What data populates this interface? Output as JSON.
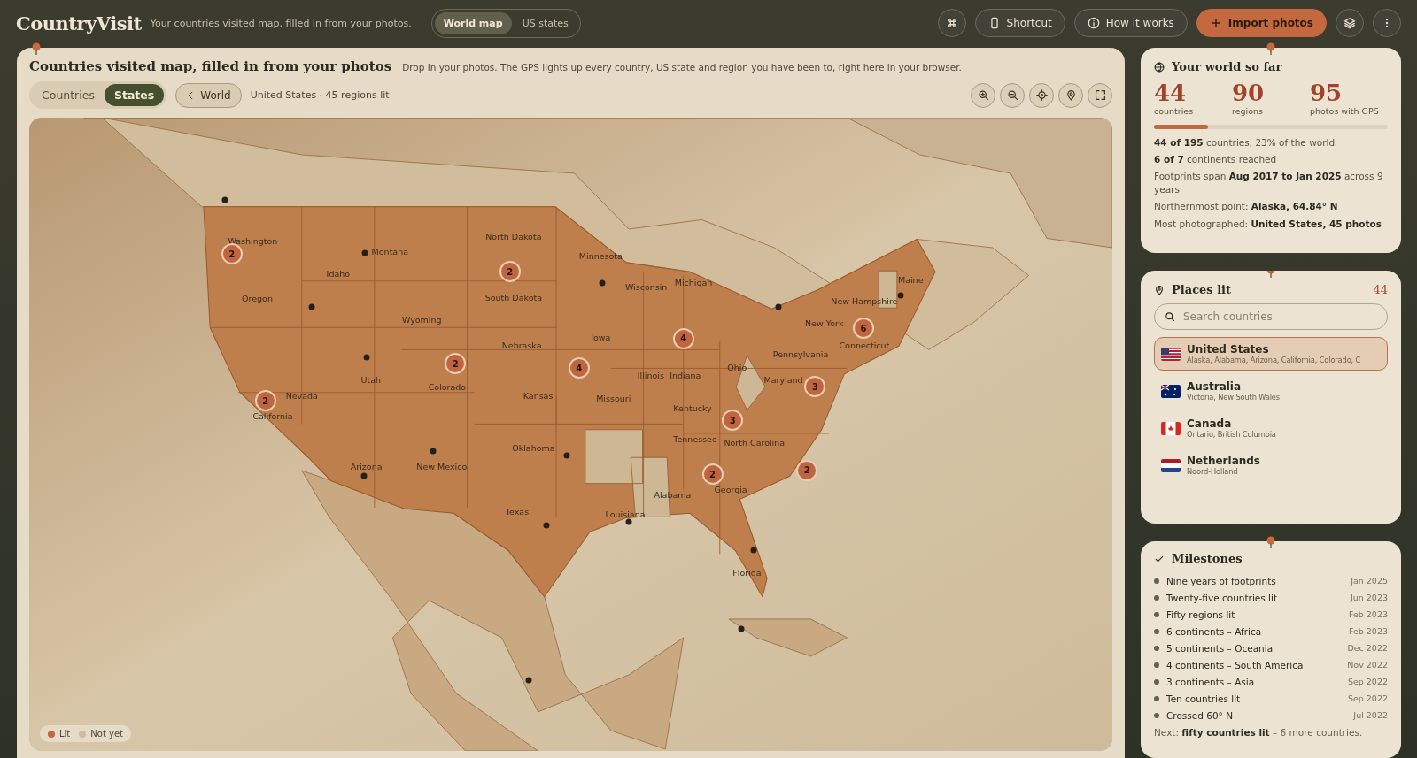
{
  "header": {
    "logo": "CountryVisit",
    "tagline": "Your countries visited map, filled in from your photos.",
    "views": [
      {
        "label": "World map",
        "selected": true
      },
      {
        "label": "US states",
        "selected": false
      }
    ],
    "shortcut": "Shortcut",
    "how": "How it works",
    "import": "Import photos"
  },
  "map_card": {
    "title": "Countries visited map, filled in from your photos",
    "subtitle": "Drop in your photos. The GPS lights up every country, US state and region you have been to, right here in your browser.",
    "levels": [
      {
        "label": "Countries",
        "selected": false
      },
      {
        "label": "States",
        "selected": true
      }
    ],
    "back": "World",
    "status": "United States · 45 regions lit",
    "labels": [
      "Washington",
      "Montana",
      "Idaho",
      "Oregon",
      "North Dakota",
      "Minnesota",
      "South Dakota",
      "Wisconsin",
      "Michigan",
      "Wyoming",
      "Nebraska",
      "Iowa",
      "Maine",
      "New Hampshire",
      "New York",
      "Connecticut",
      "Pennsylvania",
      "Ohio",
      "Illinois",
      "Indiana",
      "Nevada",
      "Utah",
      "Colorado",
      "Kansas",
      "Missouri",
      "Kentucky",
      "Maryland",
      "California",
      "Tennessee",
      "North Carolina",
      "Oklahoma",
      "Arizona",
      "New Mexico",
      "Alabama",
      "Georgia",
      "Texas",
      "Louisiana",
      "Florida"
    ],
    "clusters": [
      {
        "count": "2"
      },
      {
        "count": "2"
      },
      {
        "count": "2"
      },
      {
        "count": "2"
      },
      {
        "count": "4"
      },
      {
        "count": "4"
      },
      {
        "count": "3"
      },
      {
        "count": "6"
      },
      {
        "count": "3"
      },
      {
        "count": "2"
      },
      {
        "count": "2"
      }
    ],
    "legend": [
      {
        "label": "Lit",
        "color": "#c0683f"
      },
      {
        "label": "Not yet",
        "color": "#cdbb9e"
      }
    ]
  },
  "summary": {
    "title": "Your world so far",
    "stats": [
      {
        "value": "44",
        "label": "countries"
      },
      {
        "value": "90",
        "label": "regions"
      },
      {
        "value": "95",
        "label": "photos with GPS"
      }
    ],
    "progress": {
      "level": 0.23
    },
    "facts": [
      "**44 of 195** countries, 23% of the world",
      "**6 of 7** continents reached",
      "Footprints span **Aug 2017 to Jan 2025** across 9 years",
      "Northernmost point: **Alaska, 64.84° N**",
      "Most photographed: **United States, 45 photos**"
    ]
  },
  "places": {
    "title": "Places lit",
    "count": "44",
    "placeholder": "Search countries",
    "items": [
      {
        "name": "United States",
        "regions": "Alaska, Alabama, Arizona, California, Colorado, C",
        "selected": true
      },
      {
        "name": "Australia",
        "regions": "Victoria, New South Wales",
        "selected": false
      },
      {
        "name": "Canada",
        "regions": "Ontario, British Columbia",
        "selected": false
      },
      {
        "name": "Netherlands",
        "regions": "Noord-Holland",
        "selected": false
      }
    ]
  },
  "milestones": {
    "title": "Milestones",
    "items": [
      {
        "label": "Nine years of footprints",
        "date": "Jan 2025"
      },
      {
        "label": "Twenty-five countries lit",
        "date": "Jun 2023"
      },
      {
        "label": "Fifty regions lit",
        "date": "Feb 2023"
      },
      {
        "label": "6 continents – Africa",
        "date": "Feb 2023"
      },
      {
        "label": "5 continents – Oceania",
        "date": "Dec 2022"
      },
      {
        "label": "4 continents – South America",
        "date": "Nov 2022"
      },
      {
        "label": "3 continents – Asia",
        "date": "Sep 2022"
      },
      {
        "label": "Ten countries lit",
        "date": "Sep 2022"
      },
      {
        "label": "Crossed 60° N",
        "date": "Jul 2022"
      }
    ],
    "next": "Next: **fifty countries lit** – 6 more countries."
  }
}
